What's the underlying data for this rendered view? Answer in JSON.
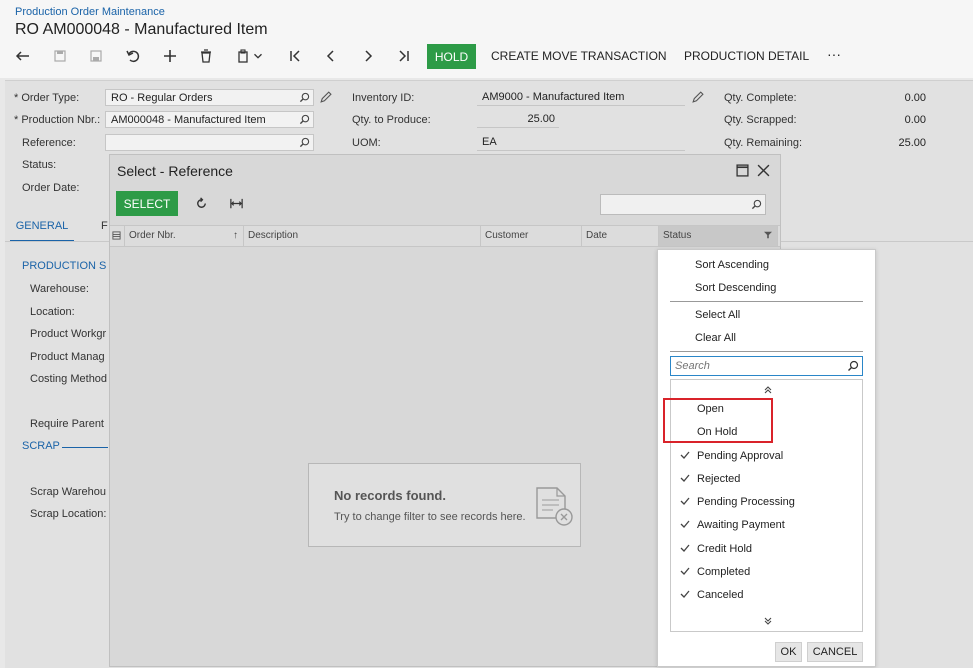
{
  "header": {
    "breadcrumb": "Production Order Maintenance",
    "title": "RO AM000048 - Manufactured Item",
    "hold_label": "HOLD",
    "create_move_label": "CREATE MOVE TRANSACTION",
    "production_detail_label": "PRODUCTION DETAIL",
    "more_label": "···"
  },
  "form": {
    "order_type_label": "* Order Type:",
    "order_type_value": "RO - Regular Orders",
    "production_nbr_label": "* Production Nbr.:",
    "production_nbr_value": "AM000048 - Manufactured Item",
    "reference_label": "Reference:",
    "status_label": "Status:",
    "order_date_label": "Order Date:",
    "inventory_id_label": "Inventory ID:",
    "inventory_id_value": "AM9000 - Manufactured Item",
    "qty_to_produce_label": "Qty. to Produce:",
    "qty_to_produce_value": "25.00",
    "uom_label": "UOM:",
    "uom_value": "EA",
    "qty_complete_label": "Qty. Complete:",
    "qty_complete_value": "0.00",
    "qty_scrapped_label": "Qty. Scrapped:",
    "qty_scrapped_value": "0.00",
    "qty_remaining_label": "Qty. Remaining:",
    "qty_remaining_value": "25.00"
  },
  "tabs": {
    "general": "GENERAL",
    "partial": "F"
  },
  "general": {
    "production_section": "PRODUCTION S",
    "warehouse": "Warehouse:",
    "location": "Location:",
    "product_workgroup": "Product Workgr",
    "product_manager": "Product Manag",
    "costing_method": "Costing Method",
    "require_parent": "Require Parent",
    "scrap_section": "SCRAP",
    "scrap_warehouse": "Scrap Warehou",
    "scrap_location": "Scrap Location:"
  },
  "dialog": {
    "title": "Select - Reference",
    "select_label": "SELECT",
    "columns": [
      "Order Nbr.",
      "Description",
      "Customer",
      "Date",
      "Status"
    ],
    "no_records_title": "No records found.",
    "no_records_hint": "Try to change filter to see records here."
  },
  "filter_menu": {
    "sort_ascending": "Sort Ascending",
    "sort_descending": "Sort Descending",
    "select_all": "Select All",
    "clear_all": "Clear All",
    "search_placeholder": "Search",
    "options": [
      {
        "label": "Open",
        "checked": false
      },
      {
        "label": "On Hold",
        "checked": false
      },
      {
        "label": "Pending Approval",
        "checked": true
      },
      {
        "label": "Rejected",
        "checked": true
      },
      {
        "label": "Pending Processing",
        "checked": true
      },
      {
        "label": "Awaiting Payment",
        "checked": true
      },
      {
        "label": "Credit Hold",
        "checked": true
      },
      {
        "label": "Completed",
        "checked": true
      },
      {
        "label": "Canceled",
        "checked": true
      }
    ],
    "ok_label": "OK",
    "cancel_label": "CANCEL"
  },
  "colors": {
    "accent_green": "#2d9b47",
    "link_blue": "#1a63a8",
    "highlight_red": "#d9232a"
  }
}
